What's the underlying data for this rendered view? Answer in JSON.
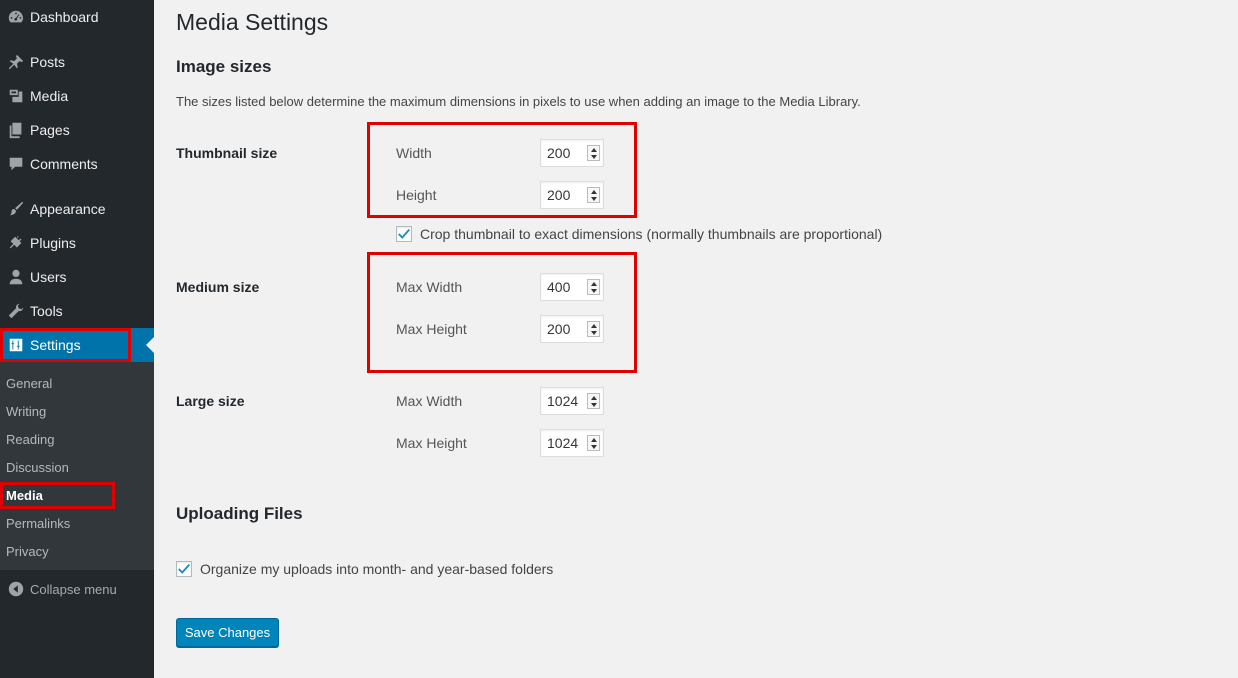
{
  "sidebar": {
    "menu": [
      {
        "label": "Dashboard",
        "icon": "dashboard-icon"
      },
      {
        "label": "Posts",
        "icon": "pushpin-icon"
      },
      {
        "label": "Media",
        "icon": "media-icon"
      },
      {
        "label": "Pages",
        "icon": "pages-icon"
      },
      {
        "label": "Comments",
        "icon": "comment-icon"
      },
      {
        "label": "Appearance",
        "icon": "paintbrush-icon"
      },
      {
        "label": "Plugins",
        "icon": "plugin-icon"
      },
      {
        "label": "Users",
        "icon": "user-icon"
      },
      {
        "label": "Tools",
        "icon": "wrench-icon"
      },
      {
        "label": "Settings",
        "icon": "settings-icon"
      }
    ],
    "submenu": [
      "General",
      "Writing",
      "Reading",
      "Discussion",
      "Media",
      "Permalinks",
      "Privacy"
    ],
    "collapse_label": "Collapse menu",
    "current_menu": "Settings",
    "current_submenu": "Media"
  },
  "page": {
    "title": "Media Settings",
    "image_sizes": {
      "heading": "Image sizes",
      "description": "The sizes listed below determine the maximum dimensions in pixels to use when adding an image to the Media Library.",
      "thumbnail": {
        "label": "Thumbnail size",
        "width_label": "Width",
        "width_value": "200",
        "height_label": "Height",
        "height_value": "200",
        "crop_label": "Crop thumbnail to exact dimensions (normally thumbnails are proportional)",
        "crop_checked": true
      },
      "medium": {
        "label": "Medium size",
        "width_label": "Max Width",
        "width_value": "400",
        "height_label": "Max Height",
        "height_value": "200"
      },
      "large": {
        "label": "Large size",
        "width_label": "Max Width",
        "width_value": "1024",
        "height_label": "Max Height",
        "height_value": "1024"
      }
    },
    "uploading": {
      "heading": "Uploading Files",
      "organize_label": "Organize my uploads into month- and year-based folders",
      "organize_checked": true
    },
    "save_label": "Save Changes"
  },
  "colors": {
    "sidebar_bg": "#23282d",
    "submenu_bg": "#32373c",
    "accent": "#0073aa",
    "button": "#0085ba",
    "highlight_box": "#e00000"
  }
}
